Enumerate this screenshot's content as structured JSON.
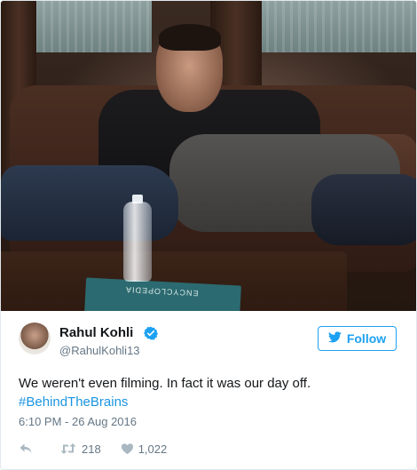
{
  "tweet": {
    "author_name": "Rahul Kohli",
    "handle": "@RahulKohli13",
    "text": "We weren't even filming. In fact it was our day off.",
    "hashtag": "#BehindTheBrains",
    "timestamp": "6:10 PM - 26 Aug 2016",
    "retweets": "218",
    "likes": "1,022"
  },
  "follow_button": {
    "label": "Follow",
    "icon": "twitter-bird-icon"
  },
  "photo": {
    "book_label": "ENCYCLOPEDIA"
  },
  "icons": {
    "verified": "verified-badge-icon",
    "reply": "reply-icon",
    "retweet": "retweet-icon",
    "like": "heart-icon"
  },
  "colors": {
    "accent": "#1da1f2",
    "hashtag": "#1b95e0",
    "muted": "#657786",
    "text": "#14171a"
  }
}
